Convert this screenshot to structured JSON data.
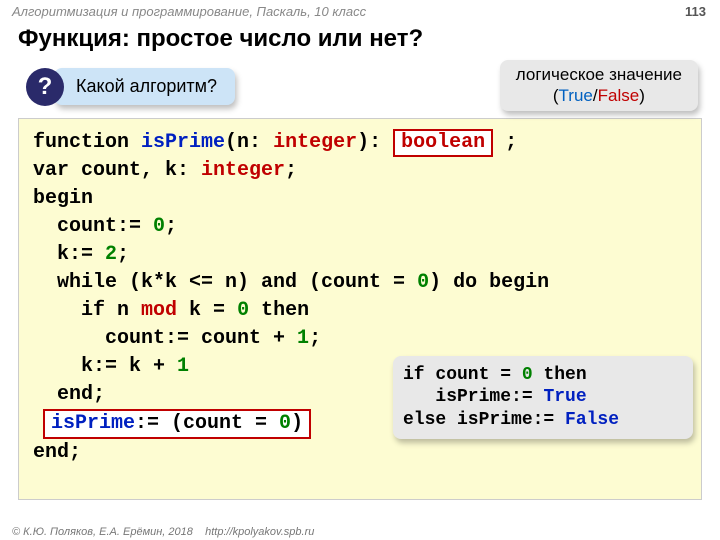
{
  "header": "Алгоритмизация и программирование, Паскаль, 10 класс",
  "page_num": "113",
  "title": "Функция: простое число или нет?",
  "question_mark": "?",
  "question_text": "Какой алгоритм?",
  "logic_bubble": {
    "line1": "логическое значение",
    "p1": "(",
    "true": "True",
    "slash": "/",
    "false": "False",
    "p2": ")"
  },
  "code": {
    "l1": {
      "a": "function ",
      "b": "isPrime",
      "c": "(n: ",
      "d": "integer",
      "e": "): ",
      "box": "boolean",
      "f": " ;"
    },
    "l2": {
      "a": "var count, k: ",
      "b": "integer",
      "c": ";"
    },
    "l3": "begin",
    "l4": {
      "a": "  count:= ",
      "b": "0",
      "c": ";"
    },
    "l5": {
      "a": "  k:= ",
      "b": "2",
      "c": ";"
    },
    "l6": {
      "a": "  while (k*k <= n) and (count = ",
      "b": "0",
      "c": ") do begin"
    },
    "l7": {
      "a": "    if n ",
      "b": "mod",
      "c": " k = ",
      "d": "0",
      "e": " then"
    },
    "l8": {
      "a": "      count:= count + ",
      "b": "1",
      "c": ";"
    },
    "l9": {
      "a": "    k:= k + ",
      "b": "1"
    },
    "l10": "  end;",
    "l11": {
      "a": "isPrime",
      "b": ":= (count = ",
      "c": "0",
      "d": ")"
    },
    "l12": "end;"
  },
  "alt": {
    "l1": {
      "a": "if count = ",
      "b": "0",
      "c": " then"
    },
    "l2": {
      "a": "   isPrime:= ",
      "b": "True"
    },
    "l3": {
      "a": "else isPrime:= ",
      "b": "False"
    }
  },
  "footer": {
    "copy": "© К.Ю. Поляков, Е.А. Ерёмин, 2018",
    "url": "http://kpolyakov.spb.ru"
  }
}
